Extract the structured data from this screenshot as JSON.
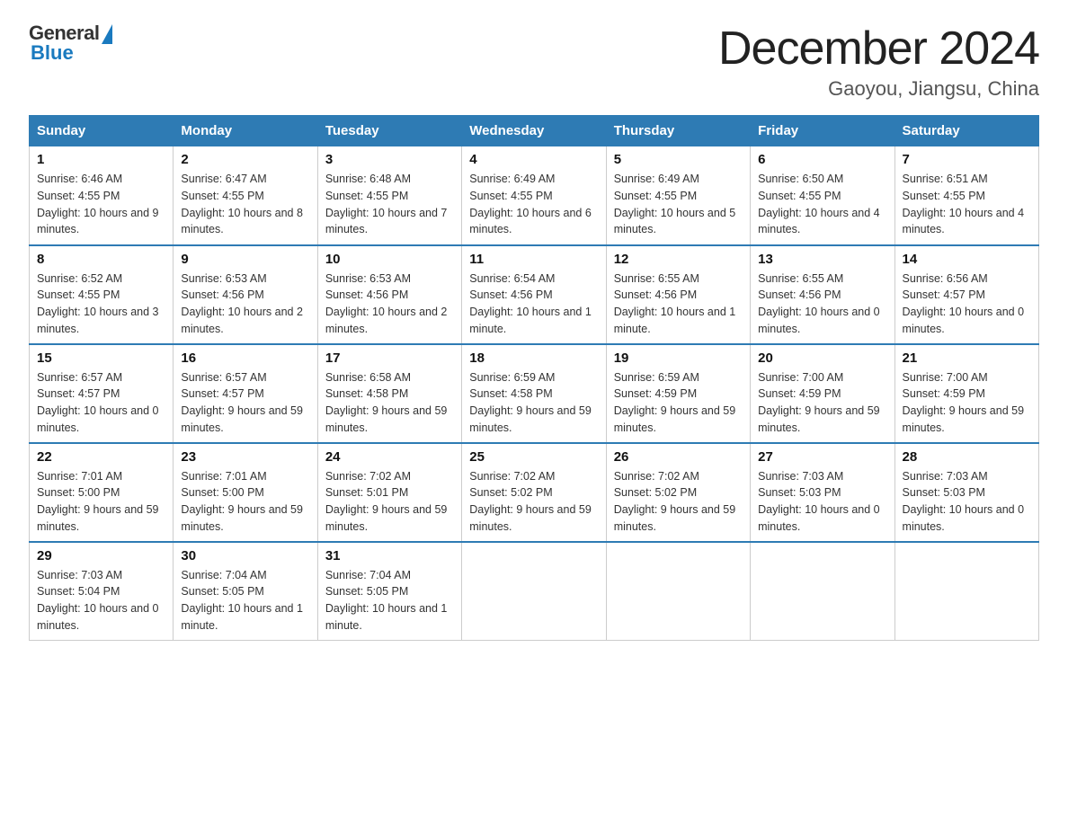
{
  "header": {
    "logo_general": "General",
    "logo_blue": "Blue",
    "title": "December 2024",
    "subtitle": "Gaoyou, Jiangsu, China"
  },
  "days_of_week": [
    "Sunday",
    "Monday",
    "Tuesday",
    "Wednesday",
    "Thursday",
    "Friday",
    "Saturday"
  ],
  "weeks": [
    [
      {
        "day": "1",
        "sunrise": "6:46 AM",
        "sunset": "4:55 PM",
        "daylight": "10 hours and 9 minutes."
      },
      {
        "day": "2",
        "sunrise": "6:47 AM",
        "sunset": "4:55 PM",
        "daylight": "10 hours and 8 minutes."
      },
      {
        "day": "3",
        "sunrise": "6:48 AM",
        "sunset": "4:55 PM",
        "daylight": "10 hours and 7 minutes."
      },
      {
        "day": "4",
        "sunrise": "6:49 AM",
        "sunset": "4:55 PM",
        "daylight": "10 hours and 6 minutes."
      },
      {
        "day": "5",
        "sunrise": "6:49 AM",
        "sunset": "4:55 PM",
        "daylight": "10 hours and 5 minutes."
      },
      {
        "day": "6",
        "sunrise": "6:50 AM",
        "sunset": "4:55 PM",
        "daylight": "10 hours and 4 minutes."
      },
      {
        "day": "7",
        "sunrise": "6:51 AM",
        "sunset": "4:55 PM",
        "daylight": "10 hours and 4 minutes."
      }
    ],
    [
      {
        "day": "8",
        "sunrise": "6:52 AM",
        "sunset": "4:55 PM",
        "daylight": "10 hours and 3 minutes."
      },
      {
        "day": "9",
        "sunrise": "6:53 AM",
        "sunset": "4:56 PM",
        "daylight": "10 hours and 2 minutes."
      },
      {
        "day": "10",
        "sunrise": "6:53 AM",
        "sunset": "4:56 PM",
        "daylight": "10 hours and 2 minutes."
      },
      {
        "day": "11",
        "sunrise": "6:54 AM",
        "sunset": "4:56 PM",
        "daylight": "10 hours and 1 minute."
      },
      {
        "day": "12",
        "sunrise": "6:55 AM",
        "sunset": "4:56 PM",
        "daylight": "10 hours and 1 minute."
      },
      {
        "day": "13",
        "sunrise": "6:55 AM",
        "sunset": "4:56 PM",
        "daylight": "10 hours and 0 minutes."
      },
      {
        "day": "14",
        "sunrise": "6:56 AM",
        "sunset": "4:57 PM",
        "daylight": "10 hours and 0 minutes."
      }
    ],
    [
      {
        "day": "15",
        "sunrise": "6:57 AM",
        "sunset": "4:57 PM",
        "daylight": "10 hours and 0 minutes."
      },
      {
        "day": "16",
        "sunrise": "6:57 AM",
        "sunset": "4:57 PM",
        "daylight": "9 hours and 59 minutes."
      },
      {
        "day": "17",
        "sunrise": "6:58 AM",
        "sunset": "4:58 PM",
        "daylight": "9 hours and 59 minutes."
      },
      {
        "day": "18",
        "sunrise": "6:59 AM",
        "sunset": "4:58 PM",
        "daylight": "9 hours and 59 minutes."
      },
      {
        "day": "19",
        "sunrise": "6:59 AM",
        "sunset": "4:59 PM",
        "daylight": "9 hours and 59 minutes."
      },
      {
        "day": "20",
        "sunrise": "7:00 AM",
        "sunset": "4:59 PM",
        "daylight": "9 hours and 59 minutes."
      },
      {
        "day": "21",
        "sunrise": "7:00 AM",
        "sunset": "4:59 PM",
        "daylight": "9 hours and 59 minutes."
      }
    ],
    [
      {
        "day": "22",
        "sunrise": "7:01 AM",
        "sunset": "5:00 PM",
        "daylight": "9 hours and 59 minutes."
      },
      {
        "day": "23",
        "sunrise": "7:01 AM",
        "sunset": "5:00 PM",
        "daylight": "9 hours and 59 minutes."
      },
      {
        "day": "24",
        "sunrise": "7:02 AM",
        "sunset": "5:01 PM",
        "daylight": "9 hours and 59 minutes."
      },
      {
        "day": "25",
        "sunrise": "7:02 AM",
        "sunset": "5:02 PM",
        "daylight": "9 hours and 59 minutes."
      },
      {
        "day": "26",
        "sunrise": "7:02 AM",
        "sunset": "5:02 PM",
        "daylight": "9 hours and 59 minutes."
      },
      {
        "day": "27",
        "sunrise": "7:03 AM",
        "sunset": "5:03 PM",
        "daylight": "10 hours and 0 minutes."
      },
      {
        "day": "28",
        "sunrise": "7:03 AM",
        "sunset": "5:03 PM",
        "daylight": "10 hours and 0 minutes."
      }
    ],
    [
      {
        "day": "29",
        "sunrise": "7:03 AM",
        "sunset": "5:04 PM",
        "daylight": "10 hours and 0 minutes."
      },
      {
        "day": "30",
        "sunrise": "7:04 AM",
        "sunset": "5:05 PM",
        "daylight": "10 hours and 1 minute."
      },
      {
        "day": "31",
        "sunrise": "7:04 AM",
        "sunset": "5:05 PM",
        "daylight": "10 hours and 1 minute."
      },
      null,
      null,
      null,
      null
    ]
  ],
  "labels": {
    "sunrise": "Sunrise:",
    "sunset": "Sunset:",
    "daylight": "Daylight:"
  }
}
